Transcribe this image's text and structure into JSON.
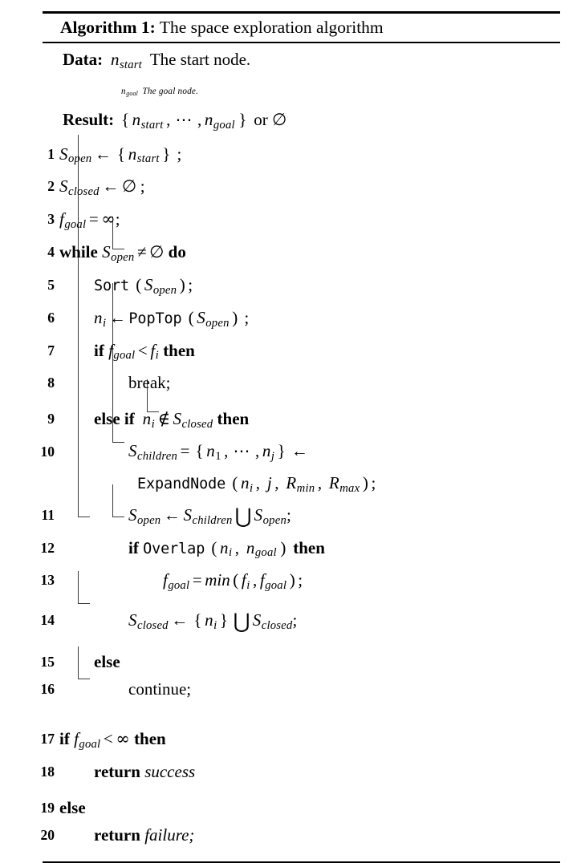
{
  "caption": {
    "label": "Algorithm 1:",
    "title": "The space exploration algorithm"
  },
  "header": {
    "data_label": "Data:",
    "data_line1_var": "n",
    "data_line1_sub": "start",
    "data_line1_text": "The start node.",
    "data_line2_var": "n",
    "data_line2_sub": "goal",
    "data_line2_text": "The goal node.",
    "result_label": "Result:",
    "result_open": "{",
    "result_v1": "n",
    "result_v1_sub": "start",
    "result_comma": ",",
    "result_dots": "⋯",
    "result_comma2": ",",
    "result_v2": "n",
    "result_v2_sub": "goal",
    "result_close": "}",
    "result_or": "or",
    "result_empty": "∅"
  },
  "symbols": {
    "assign": "←",
    "emptyset": "∅",
    "infinity": "∞",
    "neq": "≠",
    "notin": "∉",
    "lt": "<",
    "eq": "=",
    "bigcup": "⋃",
    "dots": "⋯"
  },
  "lines": [
    {
      "n": "1",
      "kind": "stmt"
    },
    {
      "n": "2",
      "kind": "stmt"
    },
    {
      "n": "3",
      "kind": "stmt"
    },
    {
      "n": "4",
      "kind": "while"
    },
    {
      "n": "5",
      "kind": "call"
    },
    {
      "n": "6",
      "kind": "call"
    },
    {
      "n": "7",
      "kind": "if"
    },
    {
      "n": "8",
      "kind": "stmt"
    },
    {
      "n": "9",
      "kind": "elseif"
    },
    {
      "n": "10",
      "kind": "stmt-wrap"
    },
    {
      "n": "11",
      "kind": "stmt"
    },
    {
      "n": "12",
      "kind": "if"
    },
    {
      "n": "13",
      "kind": "stmt"
    },
    {
      "n": "14",
      "kind": "stmt"
    },
    {
      "n": "15",
      "kind": "else"
    },
    {
      "n": "16",
      "kind": "stmt"
    },
    {
      "n": "17",
      "kind": "if"
    },
    {
      "n": "18",
      "kind": "return"
    },
    {
      "n": "19",
      "kind": "else"
    },
    {
      "n": "20",
      "kind": "return"
    }
  ],
  "keywords": {
    "while": "while",
    "do": "do",
    "if": "if",
    "then": "then",
    "else": "else",
    "else_if": "else if",
    "return": "return",
    "break": "break;",
    "continue": "continue;",
    "success": "success",
    "failure": "failure;"
  },
  "functions": {
    "sort": "Sort",
    "poptop": "PopTop",
    "expandnode": "ExpandNode",
    "overlap": "Overlap",
    "min": "min"
  },
  "vars": {
    "S": "S",
    "n": "n",
    "f": "f",
    "R": "R",
    "j": "j",
    "open": "open",
    "closed": "closed",
    "children": "children",
    "goal": "goal",
    "start": "start",
    "i": "i",
    "one": "1",
    "jsub": "j",
    "min": "min",
    "max": "max"
  },
  "punct": {
    "semi": ";",
    "comma": ",",
    "lparen": "(",
    "rparen": ")",
    "lbrace": "{",
    "rbrace": "}"
  }
}
